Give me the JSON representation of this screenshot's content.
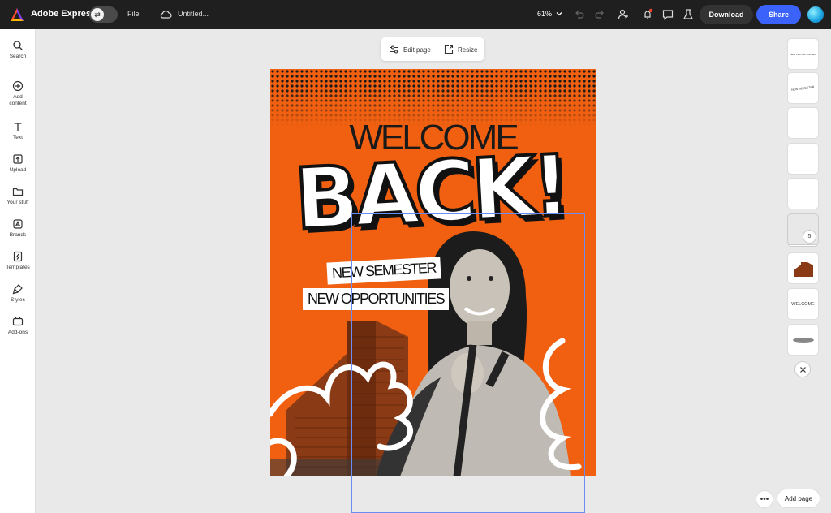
{
  "topbar": {
    "app_name": "Adobe Express",
    "file_label": "File",
    "doc_title": "Untitled...",
    "zoom": "61%",
    "download_label": "Download",
    "share_label": "Share"
  },
  "sidebar": {
    "items": [
      {
        "label": "Search",
        "icon": "search-icon"
      },
      {
        "label": "Add content",
        "icon": "plus-circle-icon"
      },
      {
        "label": "Text",
        "icon": "text-icon"
      },
      {
        "label": "Upload",
        "icon": "upload-icon"
      },
      {
        "label": "Your stuff",
        "icon": "folder-icon"
      },
      {
        "label": "Brands",
        "icon": "brand-icon"
      },
      {
        "label": "Templates",
        "icon": "templates-icon"
      },
      {
        "label": "Styles",
        "icon": "styles-icon"
      },
      {
        "label": "Add-ons",
        "icon": "addons-icon"
      }
    ]
  },
  "float_bar": {
    "edit_page": "Edit page",
    "resize": "Resize"
  },
  "canvas": {
    "welcome": "WELCOME",
    "back": "BACK!",
    "tag1": "NEW SEMESTER",
    "tag2": "NEW OPPORTUNITIES",
    "bg_color": "#f06010"
  },
  "layers": {
    "thumb1": "NEW OPPORTUNITIES",
    "thumb2": "NEW SEMESTER",
    "thumb8": "WELCOME",
    "stack_count": "5"
  },
  "footer": {
    "add_page": "Add page",
    "more": "•••"
  },
  "colors": {
    "accent": "#3b63fb",
    "topbar": "#1f1f1f",
    "selection": "#6b8cf5"
  }
}
